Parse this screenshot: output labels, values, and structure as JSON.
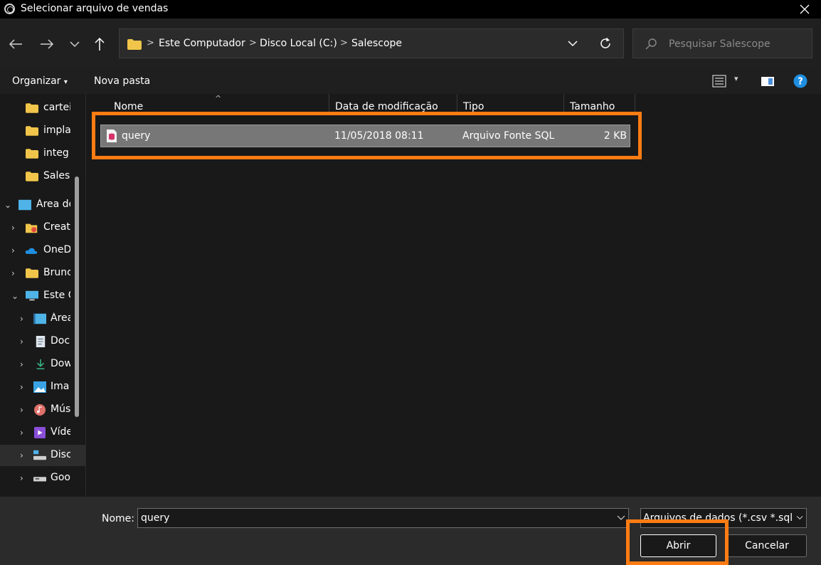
{
  "window": {
    "title": "Selecionar arquivo de vendas",
    "close_label": "✕"
  },
  "nav": {
    "breadcrumbs": [
      "Este Computador",
      "Disco Local (C:)",
      "Salescope"
    ],
    "search_placeholder": "Pesquisar Salescope"
  },
  "toolbar": {
    "organize_label": "Organizar",
    "new_folder_label": "Nova pasta"
  },
  "sidebar": {
    "items": [
      {
        "label": "cartei",
        "icon": "folder-icon"
      },
      {
        "label": "impla",
        "icon": "folder-icon"
      },
      {
        "label": "integ",
        "icon": "folder-icon"
      },
      {
        "label": "Salesc",
        "icon": "folder-icon"
      },
      {
        "label": "Área de",
        "icon": "desktop-icon"
      },
      {
        "label": "Creat",
        "icon": "creative-cloud-icon"
      },
      {
        "label": "OneD",
        "icon": "onedrive-icon"
      },
      {
        "label": "Brunc",
        "icon": "folder-icon"
      },
      {
        "label": "Este C",
        "icon": "computer-icon"
      },
      {
        "label": "Área",
        "icon": "desktop-icon"
      },
      {
        "label": "Doc",
        "icon": "documents-icon"
      },
      {
        "label": "Dow",
        "icon": "downloads-icon"
      },
      {
        "label": "Ima",
        "icon": "pictures-icon"
      },
      {
        "label": "Mús",
        "icon": "music-icon"
      },
      {
        "label": "Víde",
        "icon": "videos-icon"
      },
      {
        "label": "Disc",
        "icon": "local-disk-icon"
      },
      {
        "label": "Goo",
        "icon": "drive-icon"
      }
    ]
  },
  "columns": {
    "name": "Nome",
    "modified": "Data de modificação",
    "type": "Tipo",
    "size": "Tamanho"
  },
  "files": [
    {
      "name": "query",
      "modified": "11/05/2018 08:11",
      "type": "Arquivo Fonte SQL",
      "size": "2 KB"
    }
  ],
  "bottom": {
    "name_label": "Nome:",
    "name_value": "query",
    "filter_value": "Arquivos de dados (*.csv *.sql *.",
    "open_label": "Abrir",
    "cancel_label": "Cancelar"
  },
  "colors": {
    "accent_highlight": "#ff7c13",
    "folder": "#f0c54a",
    "help": "#1e8fe0"
  }
}
